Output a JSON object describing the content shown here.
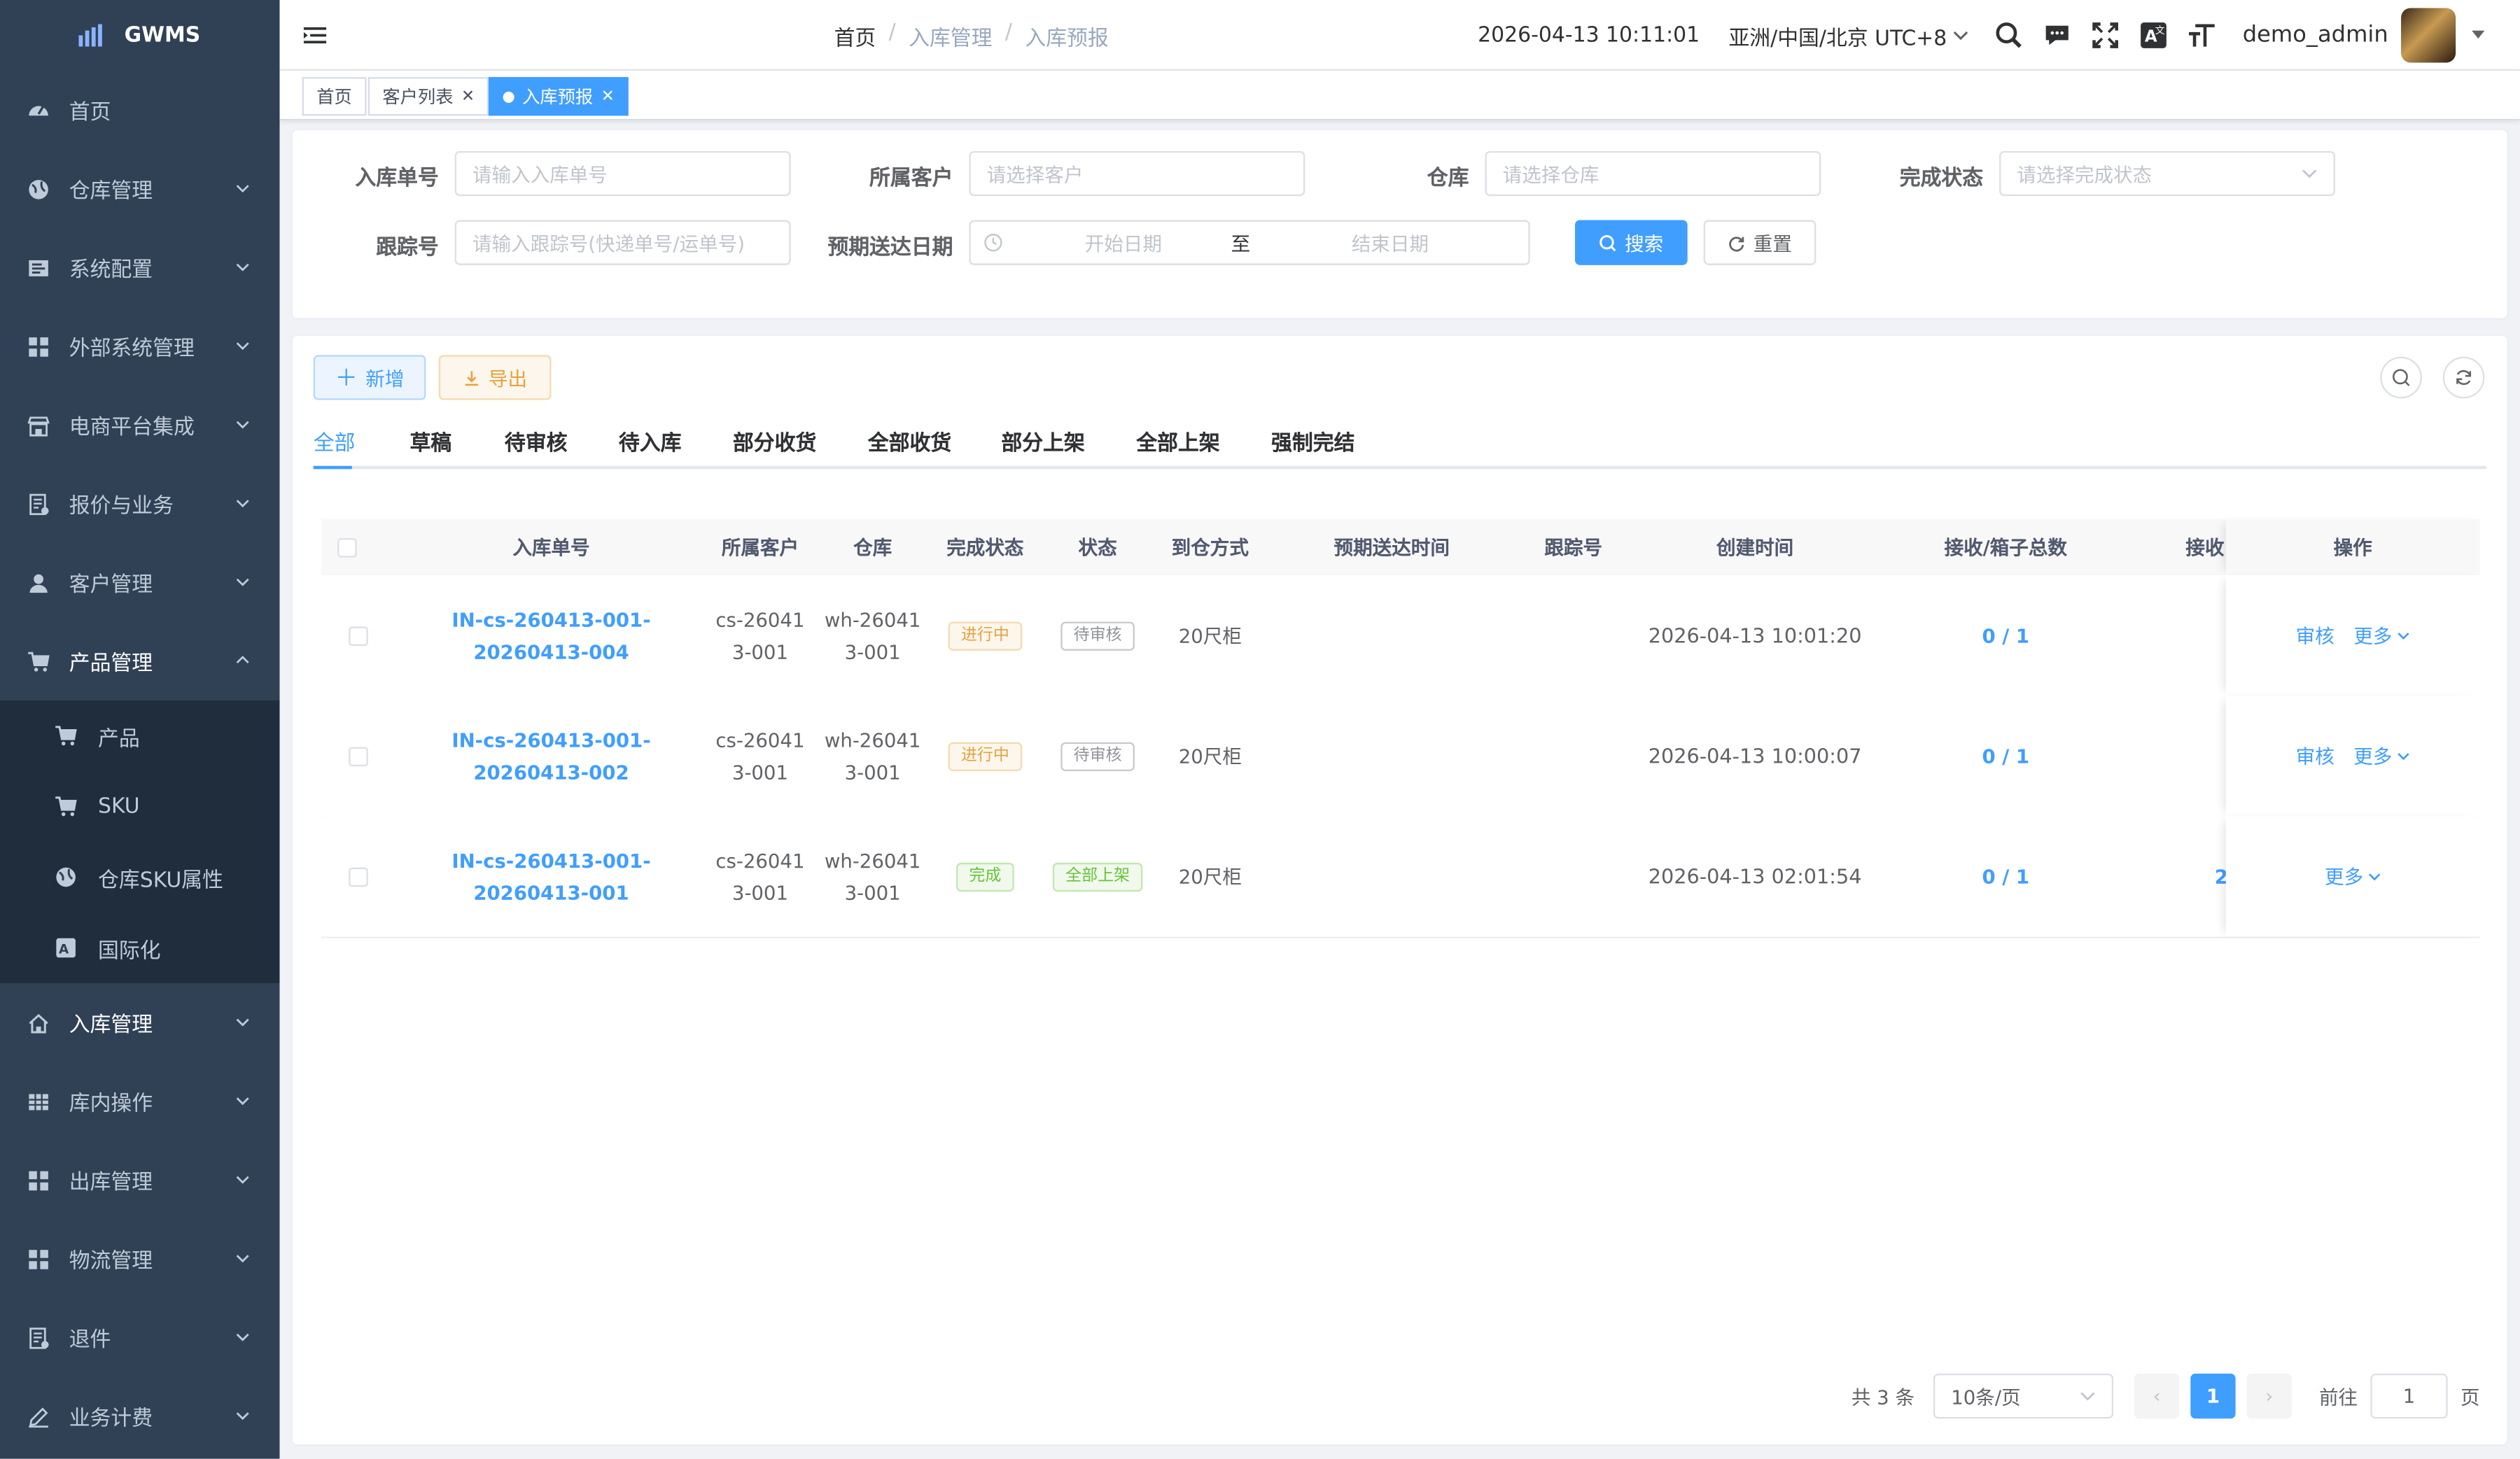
{
  "app": {
    "name": "GWMS"
  },
  "sidebar": {
    "items": [
      {
        "label": "首页",
        "icon": "dashboard-icon"
      },
      {
        "label": "仓库管理",
        "icon": "globe-icon"
      },
      {
        "label": "系统配置",
        "icon": "config-icon"
      },
      {
        "label": "外部系统管理",
        "icon": "grid-icon"
      },
      {
        "label": "电商平台集成",
        "icon": "shop-icon"
      },
      {
        "label": "报价与业务",
        "icon": "quote-icon"
      },
      {
        "label": "客户管理",
        "icon": "user-icon"
      },
      {
        "label": "产品管理",
        "icon": "cart-icon"
      }
    ],
    "sub_items": [
      {
        "label": "产品",
        "icon": "cart-icon"
      },
      {
        "label": "SKU",
        "icon": "cart-icon"
      },
      {
        "label": "仓库SKU属性",
        "icon": "globe-icon"
      },
      {
        "label": "国际化",
        "icon": "translate-icon"
      }
    ],
    "items_after": [
      {
        "label": "入库管理",
        "icon": "home-icon"
      },
      {
        "label": "库内操作",
        "icon": "table-icon"
      },
      {
        "label": "出库管理",
        "icon": "grid-icon"
      },
      {
        "label": "物流管理",
        "icon": "grid-icon"
      },
      {
        "label": "退件",
        "icon": "quote-icon"
      },
      {
        "label": "业务计费",
        "icon": "edit-icon"
      }
    ]
  },
  "header": {
    "breadcrumb": [
      "首页",
      "入库管理",
      "入库预报"
    ],
    "datetime": "2026-04-13 10:11:01",
    "timezone": "亚洲/中国/北京 UTC+8",
    "username": "demo_admin"
  },
  "tags": [
    {
      "label": "首页"
    },
    {
      "label": "客户列表"
    },
    {
      "label": "入库预报"
    }
  ],
  "search": {
    "order_no_label": "入库单号",
    "order_no_placeholder": "请输入入库单号",
    "customer_label": "所属客户",
    "customer_placeholder": "请选择客户",
    "warehouse_label": "仓库",
    "warehouse_placeholder": "请选择仓库",
    "status_label": "完成状态",
    "status_placeholder": "请选择完成状态",
    "tracking_label": "跟踪号",
    "tracking_placeholder": "请输入跟踪号(快递单号/运单号)",
    "date_label": "预期送达日期",
    "date_start": "开始日期",
    "date_to": "至",
    "date_end": "结束日期",
    "search_btn": "搜索",
    "reset_btn": "重置"
  },
  "toolbar": {
    "add_btn": "新增",
    "export_btn": "导出"
  },
  "tabs": [
    "全部",
    "草稿",
    "待审核",
    "待入库",
    "部分收货",
    "全部收货",
    "部分上架",
    "全部上架",
    "强制完结"
  ],
  "table": {
    "columns": [
      "入库单号",
      "所属客户",
      "仓库",
      "完成状态",
      "状态",
      "到仓方式",
      "预期送达时间",
      "跟踪号",
      "创建时间",
      "接收/箱子总数",
      "接收",
      "操作"
    ],
    "rows": [
      {
        "order_no": "IN-cs-260413-001-20260413-004",
        "customer": "cs-260413-001",
        "warehouse": "wh-260413-001",
        "complete_status": "进行中",
        "status": "待审核",
        "arrival": "20尺柜",
        "expected": "",
        "tracking": "",
        "created": "2026-04-13 10:01:20",
        "boxes": "0 / 1",
        "recv": "",
        "op_audit": "审核",
        "op_more": "更多"
      },
      {
        "order_no": "IN-cs-260413-001-20260413-002",
        "customer": "cs-260413-001",
        "warehouse": "wh-260413-001",
        "complete_status": "进行中",
        "status": "待审核",
        "arrival": "20尺柜",
        "expected": "",
        "tracking": "",
        "created": "2026-04-13 10:00:07",
        "boxes": "0 / 1",
        "recv": "",
        "op_audit": "审核",
        "op_more": "更多"
      },
      {
        "order_no": "IN-cs-260413-001-20260413-001",
        "customer": "cs-260413-001",
        "warehouse": "wh-260413-001",
        "complete_status": "完成",
        "status": "全部上架",
        "arrival": "20尺柜",
        "expected": "",
        "tracking": "",
        "created": "2026-04-13 02:01:54",
        "boxes": "0 / 1",
        "recv": "2",
        "op_audit": "",
        "op_more": "更多"
      }
    ]
  },
  "pagination": {
    "total": "共 3 条",
    "page_size": "10条/页",
    "current": "1",
    "goto_label": "前往",
    "goto_value": "1",
    "page_suffix": "页"
  },
  "colors": {
    "sidebar_bg": "#304156",
    "primary": "#409eff",
    "warning": "#e6a23c",
    "success": "#67c23a"
  }
}
